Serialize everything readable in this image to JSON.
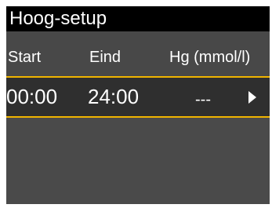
{
  "screen": {
    "title": "Hoog-setup",
    "columns": {
      "start": "Start",
      "eind": "Eind",
      "hg": "Hg (mmol/l)"
    },
    "rows": [
      {
        "start": "00:00",
        "eind": "24:00",
        "hg": "---"
      }
    ],
    "colors": {
      "title_bar": "#000000",
      "background": "#4a4a4a",
      "selected_row": "#2f2f2f",
      "selected_border": "#f0b400",
      "text": "#ffffff"
    },
    "icons": {
      "row_action": "chevron-right-icon"
    }
  }
}
